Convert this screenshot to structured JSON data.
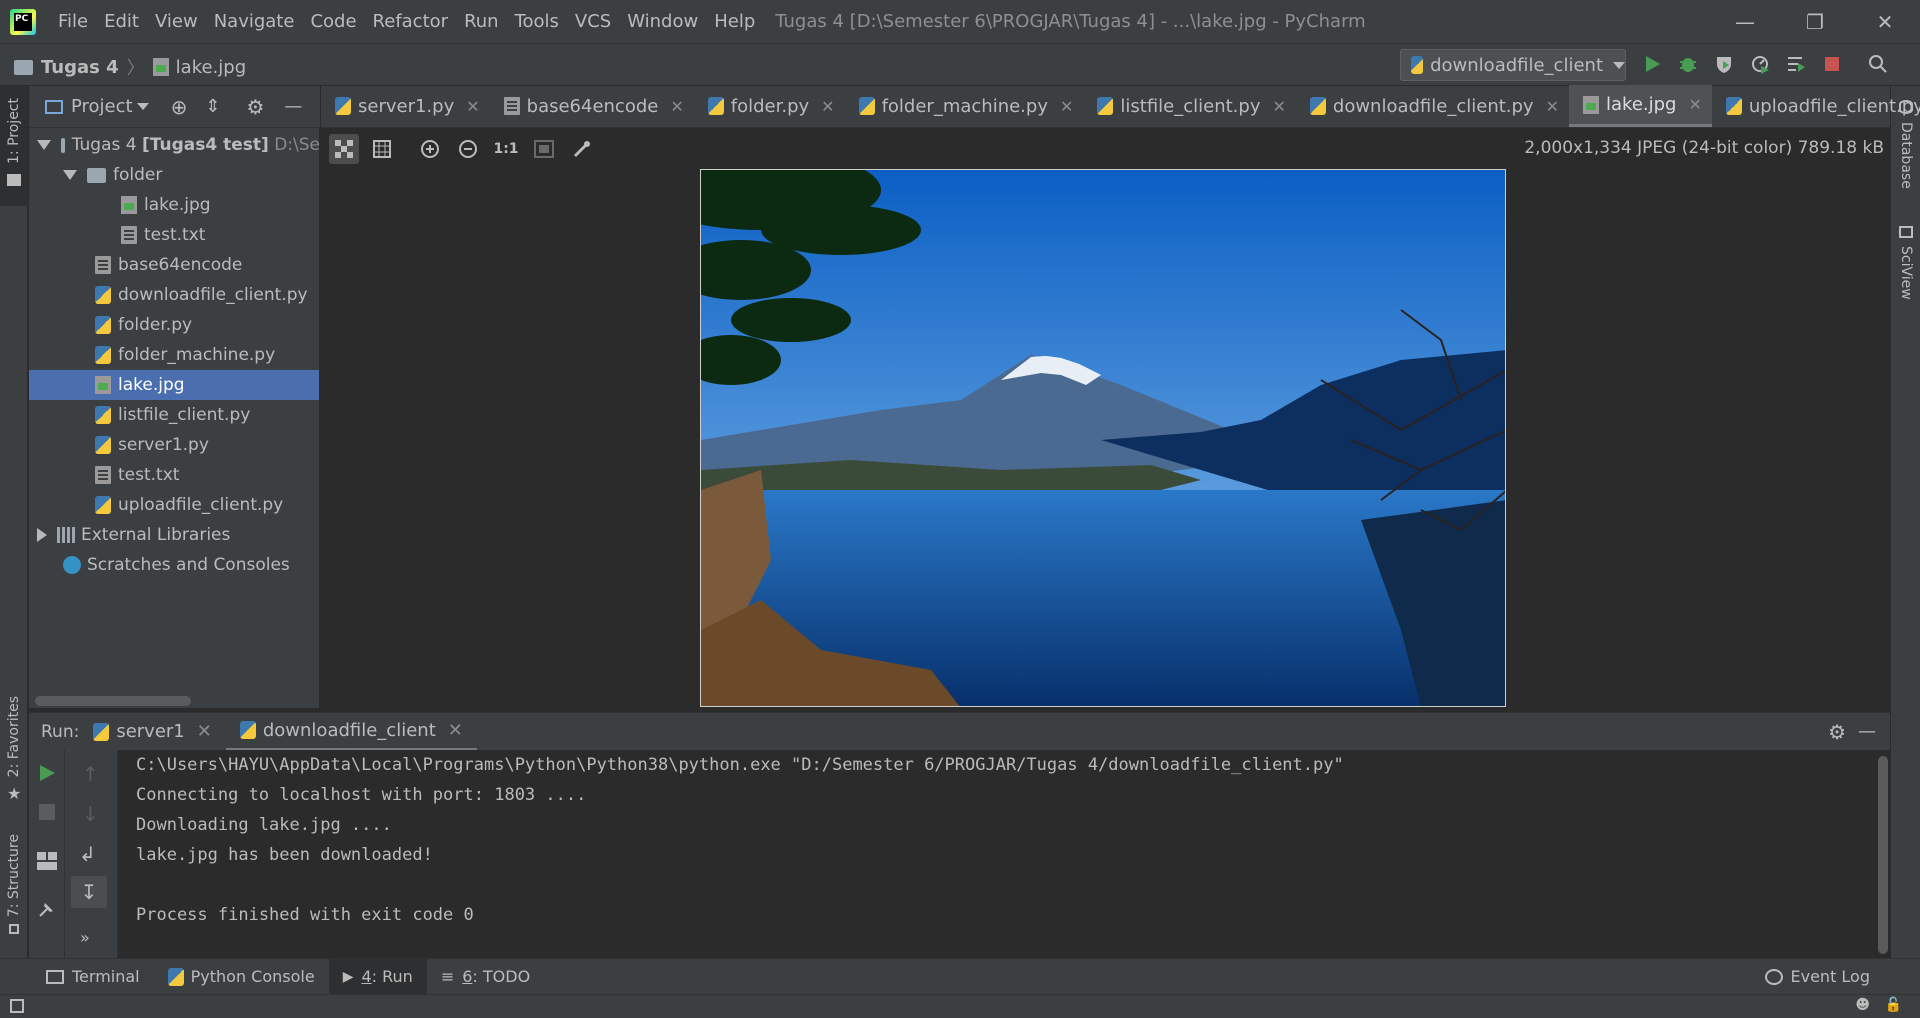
{
  "app": {
    "title": "Tugas 4 [D:\\Semester 6\\PROGJAR\\Tugas 4] - ...\\lake.jpg - PyCharm",
    "menu": [
      "File",
      "Edit",
      "View",
      "Navigate",
      "Code",
      "Refactor",
      "Run",
      "Tools",
      "VCS",
      "Window",
      "Help"
    ]
  },
  "navbar": {
    "project": "Tugas 4",
    "file": "lake.jpg",
    "run_config": "downloadfile_client"
  },
  "side_left": {
    "project_label": "1: Project",
    "favorites_label": "2: Favorites",
    "structure_label": "7: Structure"
  },
  "side_right": {
    "database_label": "Database",
    "sciview_label": "SciView"
  },
  "project_panel": {
    "title": "Project",
    "root": "Tugas 4",
    "root_bold": "[Tugas4 test]",
    "root_path": "D:\\Se",
    "folder": "folder",
    "folder_children": [
      "lake.jpg",
      "test.txt"
    ],
    "files": [
      "base64encode",
      "downloadfile_client.py",
      "folder.py",
      "folder_machine.py",
      "lake.jpg",
      "listfile_client.py",
      "server1.py",
      "test.txt",
      "uploadfile_client.py"
    ],
    "external": "External Libraries",
    "scratches": "Scratches and Consoles"
  },
  "tabs": [
    "server1.py",
    "base64encode",
    "folder.py",
    "folder_machine.py",
    "listfile_client.py",
    "downloadfile_client.py",
    "lake.jpg",
    "uploadfile_client.py"
  ],
  "tabs_overflow": "1",
  "image_editor": {
    "info": "2,000x1,334 JPEG (24-bit color) 789.18 kB",
    "zoom_actual": "1:1"
  },
  "run": {
    "label": "Run:",
    "tabs": [
      "server1",
      "downloadfile_client"
    ],
    "console": [
      "C:\\Users\\HAYU\\AppData\\Local\\Programs\\Python\\Python38\\python.exe \"D:/Semester 6/PROGJAR/Tugas 4/downloadfile_client.py\"",
      "Connecting to localhost with port: 1803 ....",
      "Downloading lake.jpg ....",
      "lake.jpg has been downloaded!",
      "",
      "Process finished with exit code 0"
    ]
  },
  "bottom": {
    "terminal": "Terminal",
    "python_console": "Python Console",
    "run_num": "4",
    "run": ": Run",
    "todo_num": "6",
    "todo": ": TODO",
    "event_log": "Event Log"
  },
  "colors": {
    "selection": "#4b6eaf",
    "run_green": "#499c54",
    "stop_red": "#c75450",
    "sky": "#2f7fd8",
    "lake": "#0f4f9a"
  }
}
